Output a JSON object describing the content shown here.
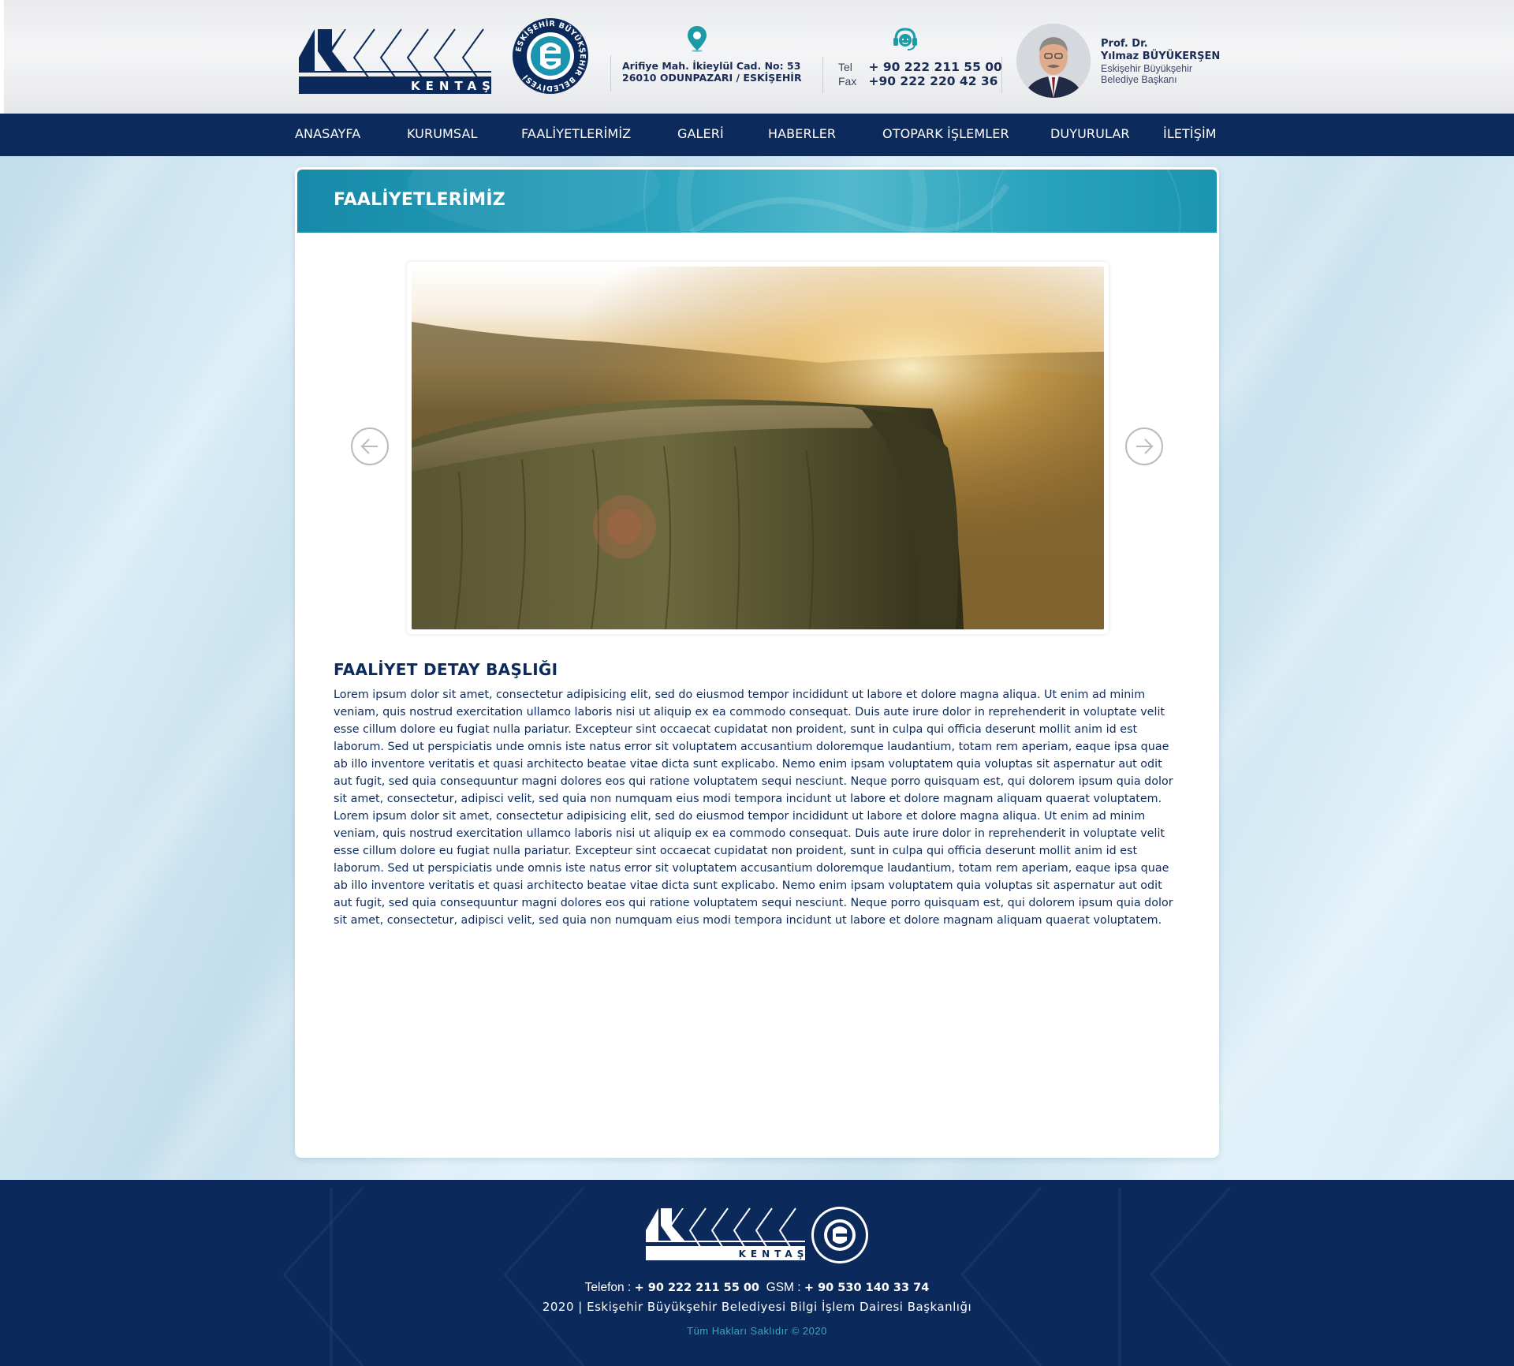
{
  "header": {
    "logo_text": "KENTAŞ",
    "seal_text": "ESKİŞEHİR BÜYÜKŞEHİR BELEDİYESİ",
    "address": {
      "icon": "map-pin-icon",
      "line1": "Arifiye Mah. İkieylül Cad. No: 53",
      "line2": "26010 ODUNPAZARI / ESKİŞEHİR"
    },
    "contact": {
      "icon": "headset-icon",
      "tel_label": "Tel",
      "tel_value": "+ 90 222 211 55 00",
      "fax_label": "Fax",
      "fax_value": "+90 222 220 42 36"
    },
    "mayor": {
      "title": "Prof. Dr.",
      "name": "Yılmaz BÜYÜKERŞEN",
      "role_line1": "Eskişehir Büyükşehir",
      "role_line2": "Belediye Başkanı"
    }
  },
  "nav": {
    "items": [
      {
        "label": "ANASAYFA"
      },
      {
        "label": "KURUMSAL"
      },
      {
        "label": "FAALİYETLERİMİZ"
      },
      {
        "label": "GALERİ"
      },
      {
        "label": "HABERLER"
      },
      {
        "label": "OTOPARK İŞLEMLER"
      },
      {
        "label": "DUYURULAR"
      },
      {
        "label": "İLETİŞİM"
      }
    ]
  },
  "page": {
    "banner_title": "FAALİYETLERİMİZ",
    "slider": {
      "prev_icon": "arrow-left-icon",
      "next_icon": "arrow-right-icon"
    },
    "detail_title": "FAALİYET DETAY BAŞLIĞI",
    "detail_body": "Lorem ipsum dolor sit amet, consectetur adipisicing elit, sed do eiusmod tempor incididunt ut labore et dolore magna aliqua. Ut enim ad minim veniam, quis nostrud exercitation ullamco laboris nisi ut aliquip ex ea commodo consequat. Duis aute irure dolor in reprehenderit in voluptate velit esse cillum dolore eu fugiat nulla pariatur. Excepteur sint occaecat cupidatat non proident, sunt in culpa qui officia deserunt mollit anim id est laborum. Sed ut perspiciatis unde omnis iste natus error sit voluptatem accusantium doloremque laudantium, totam rem aperiam, eaque ipsa quae ab illo inventore veritatis et quasi architecto beatae vitae dicta sunt explicabo. Nemo enim ipsam voluptatem quia voluptas sit aspernatur aut odit aut fugit, sed quia consequuntur magni dolores eos qui ratione voluptatem sequi nesciunt. Neque porro quisquam est, qui dolorem ipsum quia dolor sit amet, consectetur, adipisci velit, sed quia non numquam eius modi tempora incidunt ut labore et dolore magnam aliquam quaerat voluptatem. Lorem ipsum dolor sit amet, consectetur adipisicing elit, sed do eiusmod tempor incididunt ut labore et dolore magna aliqua. Ut enim ad minim veniam, quis nostrud exercitation ullamco laboris nisi ut aliquip ex ea commodo consequat. Duis aute irure dolor in reprehenderit in voluptate velit esse cillum dolore eu fugiat nulla pariatur. Excepteur sint occaecat cupidatat non proident, sunt in culpa qui officia deserunt mollit anim id est laborum. Sed ut perspiciatis unde omnis iste natus error sit voluptatem accusantium doloremque laudantium, totam rem aperiam, eaque ipsa quae ab illo inventore veritatis et quasi architecto beatae vitae dicta sunt explicabo. Nemo enim ipsam voluptatem quia voluptas sit aspernatur aut odit aut fugit, sed quia consequuntur magni dolores eos qui ratione voluptatem sequi nesciunt. Neque porro quisquam est, qui dolorem ipsum quia dolor sit amet, consectetur, adipisci velit, sed quia non numquam eius modi tempora incidunt ut labore et dolore magnam aliquam quaerat voluptatem."
  },
  "footer": {
    "phone_label": "Telefon : ",
    "phone_value": "+ 90 222 211 55 00",
    "gsm_label": "GSM : ",
    "gsm_value": "+ 90 530 140 33 74",
    "copyright_line": "2020 | Eskişehir Büyükşehir Belediyesi Bilgi İşlem Dairesi Başkanlığı",
    "rights": "Tüm Hakları Saklıdır © 2020"
  },
  "colors": {
    "navy": "#0c2a5c",
    "teal": "#1b94b0",
    "footer_accent": "#3aa5c4"
  }
}
